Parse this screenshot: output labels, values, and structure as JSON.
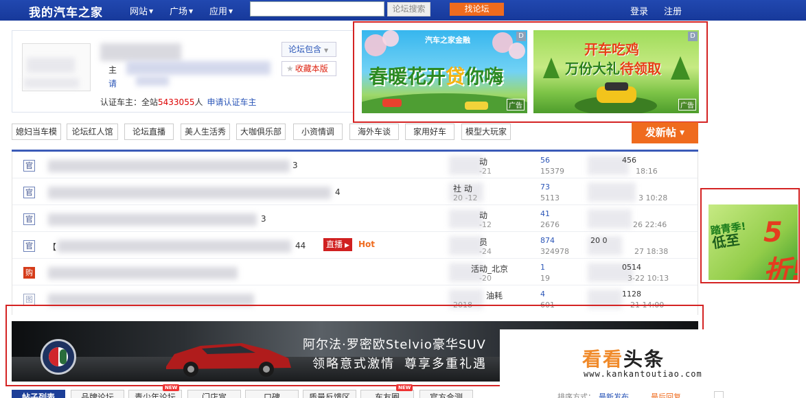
{
  "header": {
    "logo": "我的汽车之家",
    "nav": [
      {
        "label": "网站"
      },
      {
        "label": "广场"
      },
      {
        "label": "应用"
      }
    ],
    "search_placeholder": "",
    "search_button": "论坛搜索",
    "find_forum_button": "找论坛",
    "login": "登录",
    "register": "注册"
  },
  "forum_info": {
    "cert_prefix": "认证车主：全站",
    "cert_count": "5433055",
    "cert_suffix": "人",
    "apply_link": "申请认证车主",
    "pkg_button": "论坛包含",
    "fav_button": "收藏本版",
    "partial_label_1": "主",
    "partial_label_2": "请"
  },
  "ads": {
    "spring": {
      "brand": "汽车之家金融",
      "title_a": "春暖花开",
      "title_b": "贷",
      "title_c": "你嗨",
      "tag": "广告",
      "badge": "D"
    },
    "game": {
      "title_line1": "开车吃鸡",
      "title_line2_a": "万份大礼",
      "title_line2_b": "待领取",
      "tag": "广告",
      "badge": "D"
    },
    "side": {
      "line1": "踏青季!",
      "line2": "低至",
      "big": "5折!"
    }
  },
  "tags": [
    "媳妇当车模",
    "论坛红人馆",
    "论坛直播",
    "美人生活秀",
    "大咖俱乐部",
    "小资情调",
    "海外车谈",
    "家用好车",
    "模型大玩家"
  ],
  "post_button": "发新帖",
  "threads": [
    {
      "icon": "官",
      "title_end": "3",
      "author": "动",
      "author_date": "-21",
      "replies": "56",
      "views": "15379",
      "last_user": "456",
      "last_time": "18:16"
    },
    {
      "icon": "官",
      "title_end": "4",
      "author": "社   动",
      "author_date": "20     -12",
      "replies": "73",
      "views": "5113",
      "last_user": "",
      "last_time": "3 10:28"
    },
    {
      "icon": "官",
      "title_end": "3",
      "author": "动",
      "author_date": "-12",
      "replies": "41",
      "views": "2676",
      "last_user": "",
      "last_time": "26 22:46"
    },
    {
      "icon": "官",
      "title_prefix": "【",
      "title_end": "44",
      "live": "直播",
      "hot": "Hot",
      "author": "员",
      "author_date": "-24",
      "replies": "874",
      "views": "324978",
      "last_user": "20    0",
      "last_time": "27 18:38"
    },
    {
      "icon": "购",
      "title_end": "",
      "author": "活动_北京",
      "author_date": "-20",
      "replies": "1",
      "views": "19",
      "last_user": "0514",
      "last_time": "3-22 10:13"
    },
    {
      "icon": "图",
      "title_end": "",
      "author": "油耗",
      "author_date": "2018",
      "replies": "4",
      "views": "601",
      "last_user": "1128",
      "last_time": "21 14:00"
    }
  ],
  "banner": {
    "line1": "阿尔法·罗密欧Stelvio豪华SUV",
    "line2_a": "领略意式激情",
    "line2_b": "尊享多重礼遇"
  },
  "watermark": {
    "text_a": "看看",
    "text_b": "头条",
    "url": "www.kankantoutiao.com"
  },
  "tabs": [
    {
      "label": "帖子列表",
      "active": true
    },
    {
      "label": "品牌论坛"
    },
    {
      "label": "青少年论坛",
      "new": true
    },
    {
      "label": "门店宣"
    },
    {
      "label": "口碑"
    },
    {
      "label": "质量反馈区"
    },
    {
      "label": "车友圈",
      "new": true
    },
    {
      "label": "官方合测"
    }
  ],
  "new_badge": "NEW",
  "sort": {
    "label": "排序方式：",
    "opt1": "最新发布",
    "opt2": "最后回复"
  },
  "colors": {
    "topbar": "#1c3fa0",
    "accent": "#ef6b1e",
    "frame": "#d42222",
    "link": "#2a55b7"
  }
}
